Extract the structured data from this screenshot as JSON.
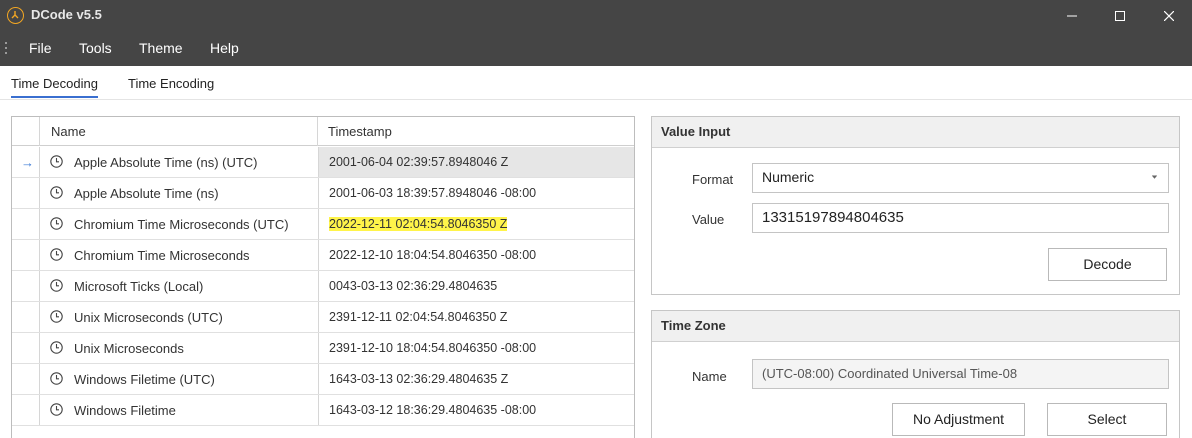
{
  "window": {
    "title": "DCode v5.5"
  },
  "menu": {
    "file": "File",
    "tools": "Tools",
    "theme": "Theme",
    "help": "Help"
  },
  "tabs": [
    {
      "label": "Time Decoding",
      "active": true
    },
    {
      "label": "Time Encoding",
      "active": false
    }
  ],
  "grid": {
    "columns": {
      "name": "Name",
      "timestamp": "Timestamp"
    },
    "rows": [
      {
        "name": "Apple Absolute Time (ns) (UTC)",
        "timestamp": "2001-06-04 02:39:57.8948046 Z",
        "selected": true
      },
      {
        "name": "Apple Absolute Time (ns)",
        "timestamp": "2001-06-03 18:39:57.8948046 -08:00"
      },
      {
        "name": "Chromium Time Microseconds (UTC)",
        "timestamp": "2022-12-11 02:04:54.8046350 Z",
        "highlighted": true
      },
      {
        "name": "Chromium Time Microseconds",
        "timestamp": "2022-12-10 18:04:54.8046350 -08:00"
      },
      {
        "name": "Microsoft Ticks (Local)",
        "timestamp": "0043-03-13 02:36:29.4804635"
      },
      {
        "name": "Unix Microseconds (UTC)",
        "timestamp": "2391-12-11 02:04:54.8046350 Z"
      },
      {
        "name": "Unix Microseconds",
        "timestamp": "2391-12-10 18:04:54.8046350 -08:00"
      },
      {
        "name": "Windows Filetime (UTC)",
        "timestamp": "1643-03-13 02:36:29.4804635 Z"
      },
      {
        "name": "Windows Filetime",
        "timestamp": "1643-03-12 18:36:29.4804635 -08:00"
      }
    ]
  },
  "value_input": {
    "title": "Value Input",
    "format_label": "Format",
    "format_value": "Numeric",
    "value_label": "Value",
    "value": "13315197894804635",
    "decode_button": "Decode"
  },
  "time_zone": {
    "title": "Time Zone",
    "name_label": "Name",
    "name_value": "(UTC-08:00) Coordinated Universal Time-08",
    "no_adjustment_button": "No Adjustment",
    "select_button": "Select"
  },
  "colors": {
    "titlebar": "#454545",
    "highlight": "#fff44a",
    "accent": "#3a78d4",
    "logo": "#f2a623"
  }
}
